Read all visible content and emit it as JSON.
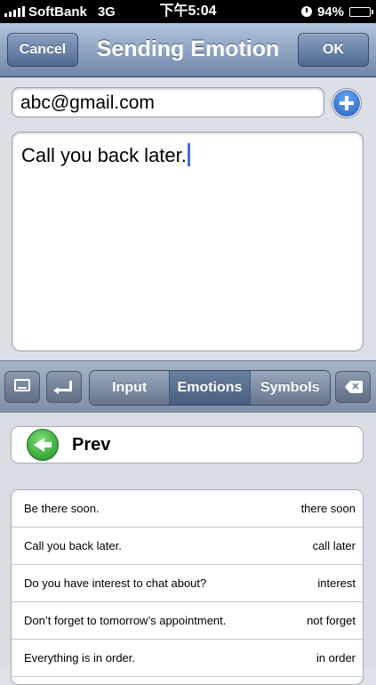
{
  "status_bar": {
    "carrier": "SoftBank",
    "network": "3G",
    "time": "下午5:04",
    "battery": "94%",
    "battery_level": 0.94
  },
  "nav": {
    "title": "Sending Emotion",
    "cancel_label": "Cancel",
    "ok_label": "OK"
  },
  "compose": {
    "to_value": "abc@gmail.com",
    "message_value": "Call you back later."
  },
  "toolbar": {
    "segments": [
      {
        "label": "Input",
        "selected": false
      },
      {
        "label": "Emotions",
        "selected": true
      },
      {
        "label": "Symbols",
        "selected": false
      }
    ]
  },
  "list": {
    "prev_label": "Prev",
    "items": [
      {
        "text": "Be there soon.",
        "key": "there soon"
      },
      {
        "text": "Call you back later.",
        "key": "call later"
      },
      {
        "text": "Do you have interest to chat about?",
        "key": "interest"
      },
      {
        "text": "Don’t forget to tomorrow’s appointment.",
        "key": "not forget"
      },
      {
        "text": "Everything is in order.",
        "key": "in order"
      }
    ]
  },
  "colors": {
    "nav_top": "#b4c4dc",
    "nav_bottom": "#6d86a9",
    "cursor": "#3f6fd1",
    "add_button": "#1f5fc6",
    "back_button": "#1e8b1f"
  }
}
